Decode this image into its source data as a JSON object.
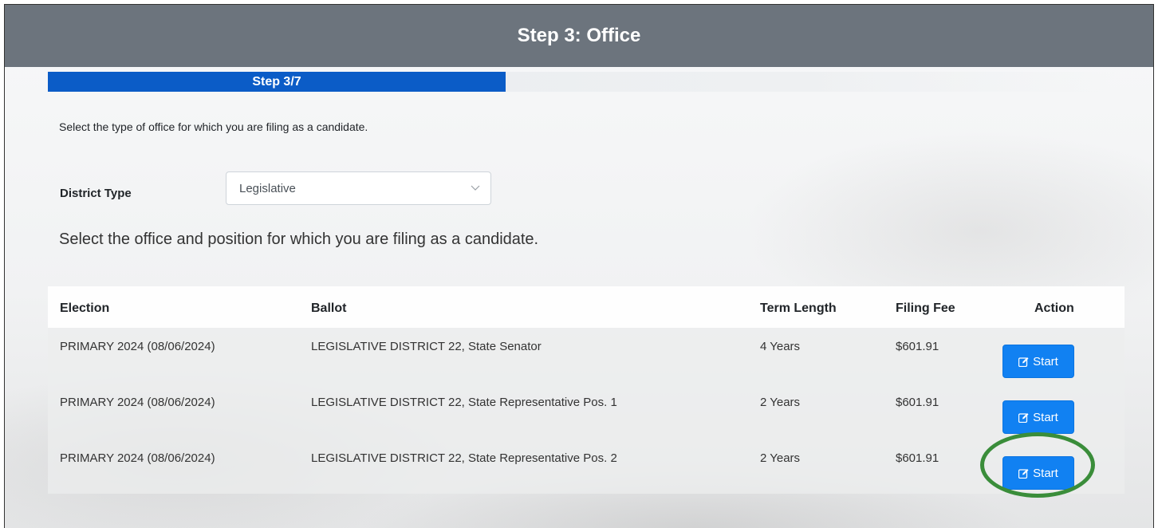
{
  "header": {
    "title": "Step 3: Office"
  },
  "progress": {
    "label": "Step 3/7",
    "current": 3,
    "total": 7,
    "fraction": 0.428
  },
  "intro_text": "Select the type of office for which you are filing as a candidate.",
  "district": {
    "label": "District Type",
    "selected": "Legislative"
  },
  "office_heading": "Select the office and position for which you are filing as a candidate.",
  "table": {
    "columns": [
      "Election",
      "Ballot",
      "Term Length",
      "Filing Fee",
      "Action"
    ],
    "rows": [
      {
        "election": "PRIMARY 2024 (08/06/2024)",
        "ballot": "LEGISLATIVE DISTRICT 22, State Senator",
        "term": "4 Years",
        "fee": "$601.91",
        "action": "Start"
      },
      {
        "election": "PRIMARY 2024 (08/06/2024)",
        "ballot": "LEGISLATIVE DISTRICT 22, State Representative Pos. 1",
        "term": "2 Years",
        "fee": "$601.91",
        "action": "Start"
      },
      {
        "election": "PRIMARY 2024 (08/06/2024)",
        "ballot": "LEGISLATIVE DISTRICT 22, State Representative Pos. 2",
        "term": "2 Years",
        "fee": "$601.91",
        "action": "Start"
      }
    ]
  },
  "icons": {
    "action_icon": "edit-icon",
    "select_icon": "chevron-down-icon"
  },
  "colors": {
    "header": "#6c747d",
    "progress": "#0b5cc7",
    "button": "#1181f2",
    "highlight": "#3a8d3a"
  }
}
